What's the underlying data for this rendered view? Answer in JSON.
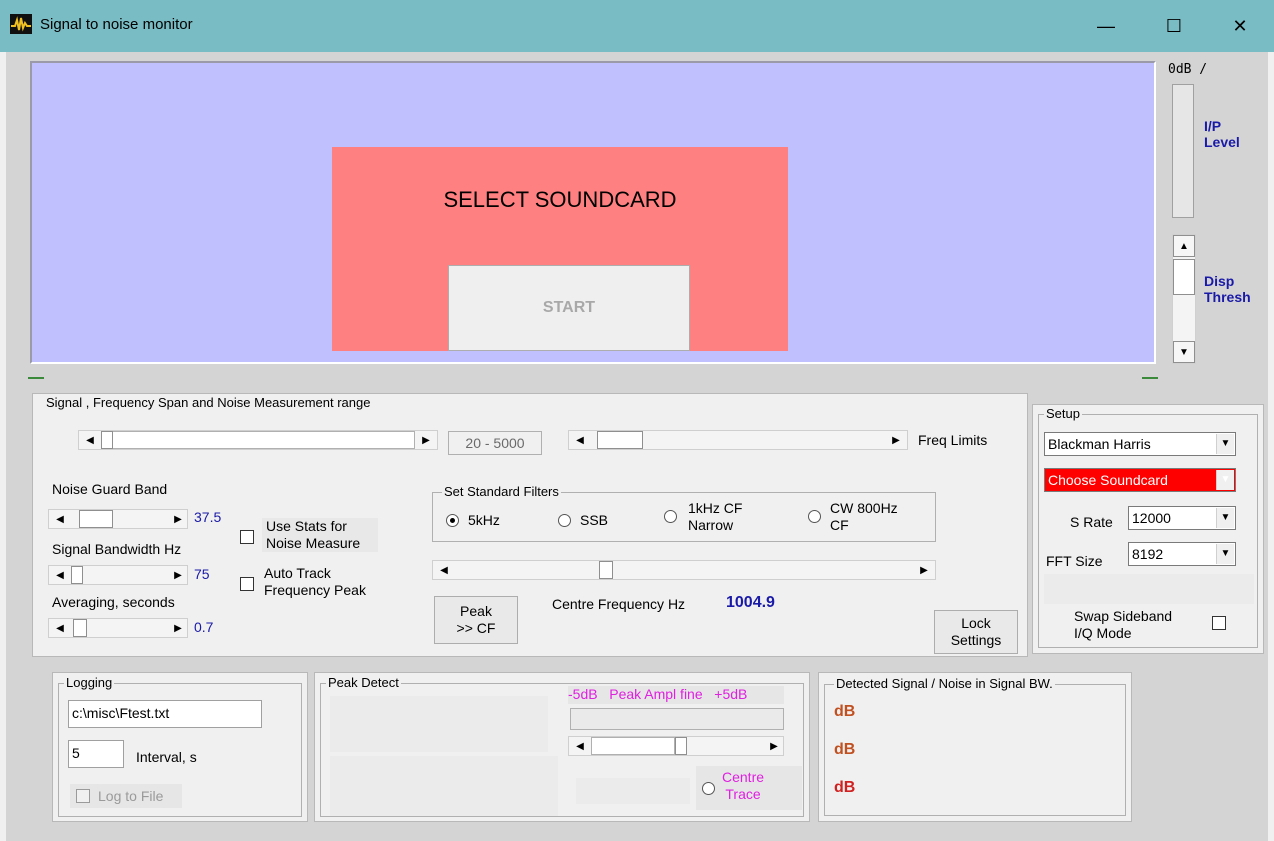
{
  "window": {
    "title": "Signal to noise monitor",
    "minimize": "—",
    "maximize": "☐",
    "close": "✕"
  },
  "display": {
    "overlay_message": "SELECT SOUNDCARD",
    "start_label": "START",
    "level_scale_top": "0dB /",
    "ip_level_label_1": "I/P",
    "ip_level_label_2": "Level",
    "disp_thresh_label_1": "Disp",
    "disp_thresh_label_2": "Thresh"
  },
  "span_group": {
    "title": "Signal , Frequency  Span and Noise Measurement range",
    "freq_range_value": "20 - 5000",
    "freq_limits_label": "Freq Limits",
    "noise_guard_label": "Noise Guard Band",
    "noise_guard_value": "37.5",
    "signal_bw_label": "Signal Bandwidth  Hz",
    "signal_bw_value": "75",
    "averaging_label": "Averaging, seconds",
    "averaging_value": "0.7",
    "use_stats_label_1": "Use Stats for",
    "use_stats_label_2": "Noise Measure",
    "auto_track_label_1": "Auto Track",
    "auto_track_label_2": "Frequency Peak",
    "filters_title": "Set Standard Filters",
    "filter_5k": "5kHz",
    "filter_ssb": "SSB",
    "filter_1k_1": "1kHz CF",
    "filter_1k_2": "Narrow",
    "filter_cw_1": "CW 800Hz",
    "filter_cw_2": "CF",
    "selected_filter": "5kHz",
    "peak_btn_1": "Peak",
    "peak_btn_2": ">> CF",
    "centre_freq_label": "Centre Frequency  Hz",
    "centre_freq_value": "1004.9",
    "lock_btn_1": "Lock",
    "lock_btn_2": "Settings"
  },
  "setup": {
    "title": "Setup",
    "window_fn": "Blackman Harris",
    "soundcard": "Choose Soundcard",
    "srate_label": "S Rate",
    "srate_value": "12000",
    "fft_label": "FFT Size",
    "fft_value": "8192",
    "swap_label_1": "Swap Sideband",
    "swap_label_2": "I/Q Mode"
  },
  "logging": {
    "title": "Logging",
    "file_path": "c:\\misc\\Ftest.txt",
    "interval_value": "5",
    "interval_label": "Interval, s",
    "log_to_file_label": "Log to File"
  },
  "peak_detect": {
    "title": "Peak Detect",
    "ampl_fine_label": "-5dB   Peak Ampl fine   +5dB",
    "centre_trace_1": "Centre",
    "centre_trace_2": "Trace"
  },
  "detected": {
    "title": "Detected Signal / Noise in Signal BW.",
    "row1": "dB",
    "row2": "dB",
    "row3": "dB"
  },
  "colors": {
    "titlebar": "#79bcc4",
    "spectrum_bg": "#c0c0ff",
    "overlay": "#ff8080",
    "soundcard_alert": "#ff0000",
    "accent_blue": "#1a1aa8",
    "magenta": "#e020e0",
    "db_orange": "#c05020",
    "db_red": "#d02020"
  }
}
